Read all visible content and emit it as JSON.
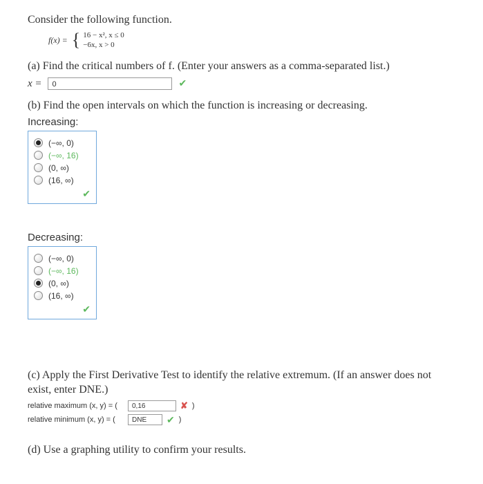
{
  "intro": "Consider the following function.",
  "formula": {
    "fx": "f(x) =",
    "piece1": "16 − x²,   x ≤ 0",
    "piece2": "−6x,   x > 0"
  },
  "partA": {
    "text": "(a) Find the critical numbers of f. (Enter your answers as a comma-separated list.)",
    "label": "x =",
    "value": "0"
  },
  "partB": {
    "text": "(b) Find the open intervals on which the function is increasing or decreasing.",
    "increasing": {
      "heading": "Increasing:",
      "options": [
        "(−∞, 0)",
        "(−∞, 16)",
        "(0, ∞)",
        "(16, ∞)"
      ],
      "selected": 0
    },
    "decreasing": {
      "heading": "Decreasing:",
      "options": [
        "(−∞, 0)",
        "(−∞, 16)",
        "(0, ∞)",
        "(16, ∞)"
      ],
      "selected": 2
    }
  },
  "partC": {
    "text": "(c) Apply the First Derivative Test to identify the relative extremum. (If an answer does not exist, enter DNE.)",
    "max": {
      "label": "relative maximum (x, y) = (",
      "value": "0,16",
      "close": ")"
    },
    "min": {
      "label": "relative minimum (x, y) = (",
      "value": "DNE",
      "close": ")"
    }
  },
  "partD": {
    "text": "(d) Use a graphing utility to confirm your results."
  }
}
